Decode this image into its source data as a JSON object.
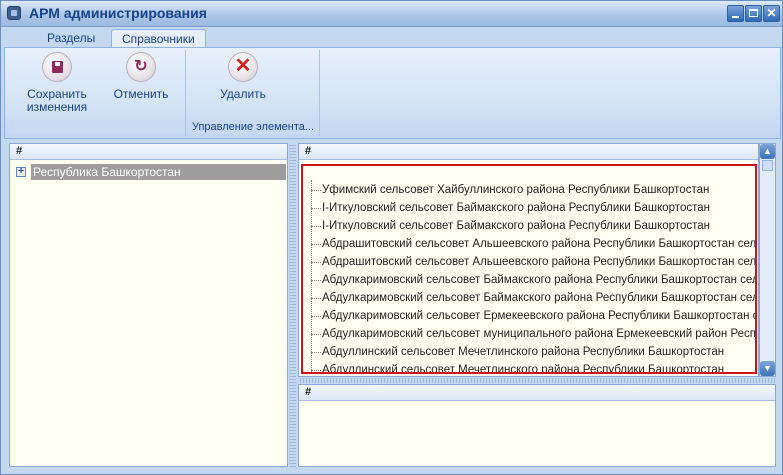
{
  "window": {
    "title": "АРМ администрирования"
  },
  "tabs": [
    {
      "label": "Разделы"
    },
    {
      "label": "Справочники"
    }
  ],
  "ribbon": {
    "save_line1": "Сохранить",
    "save_line2": "изменения",
    "cancel_label": "Отменить",
    "delete_label": "Удалить",
    "group2_label": "Управление элемента..."
  },
  "left_pane": {
    "header": "#",
    "node_label": "Республика Башкортостан"
  },
  "right_pane": {
    "header": "#",
    "items": [
      "Уфимский сельсовет Хайбуллинского района Республики Башкортостан",
      "I-Иткуловский сельсовет Баймакского района Республики Башкортостан",
      "I-Иткуловский сельсовет Баймакского района Республики Башкортостан",
      "Абдрашитовский сельсовет Альшеевского района Республики Башкортостан сель...",
      "Абдрашитовский сельсовет Альшеевского района Республики Башкортостан сель...",
      "Абдулкаримовский сельсовет Баймакского района Республики Башкортостан сель...",
      "Абдулкаримовский сельсовет Баймакского района Республики Башкортостан сель...",
      "Абдулкаримовский сельсовет Ермекеевского района Республики Башкортостан сель...",
      "Абдулкаримовский сельсовет муниципального района Ермекеевский район Республ...",
      "Абдуллинский сельсовет Мечетлинского района Республики Башкортостан",
      "Абдуллинский сельсовет Мечетлинского района Республики Башкортостан"
    ]
  },
  "bottom_pane": {
    "header": "#"
  }
}
